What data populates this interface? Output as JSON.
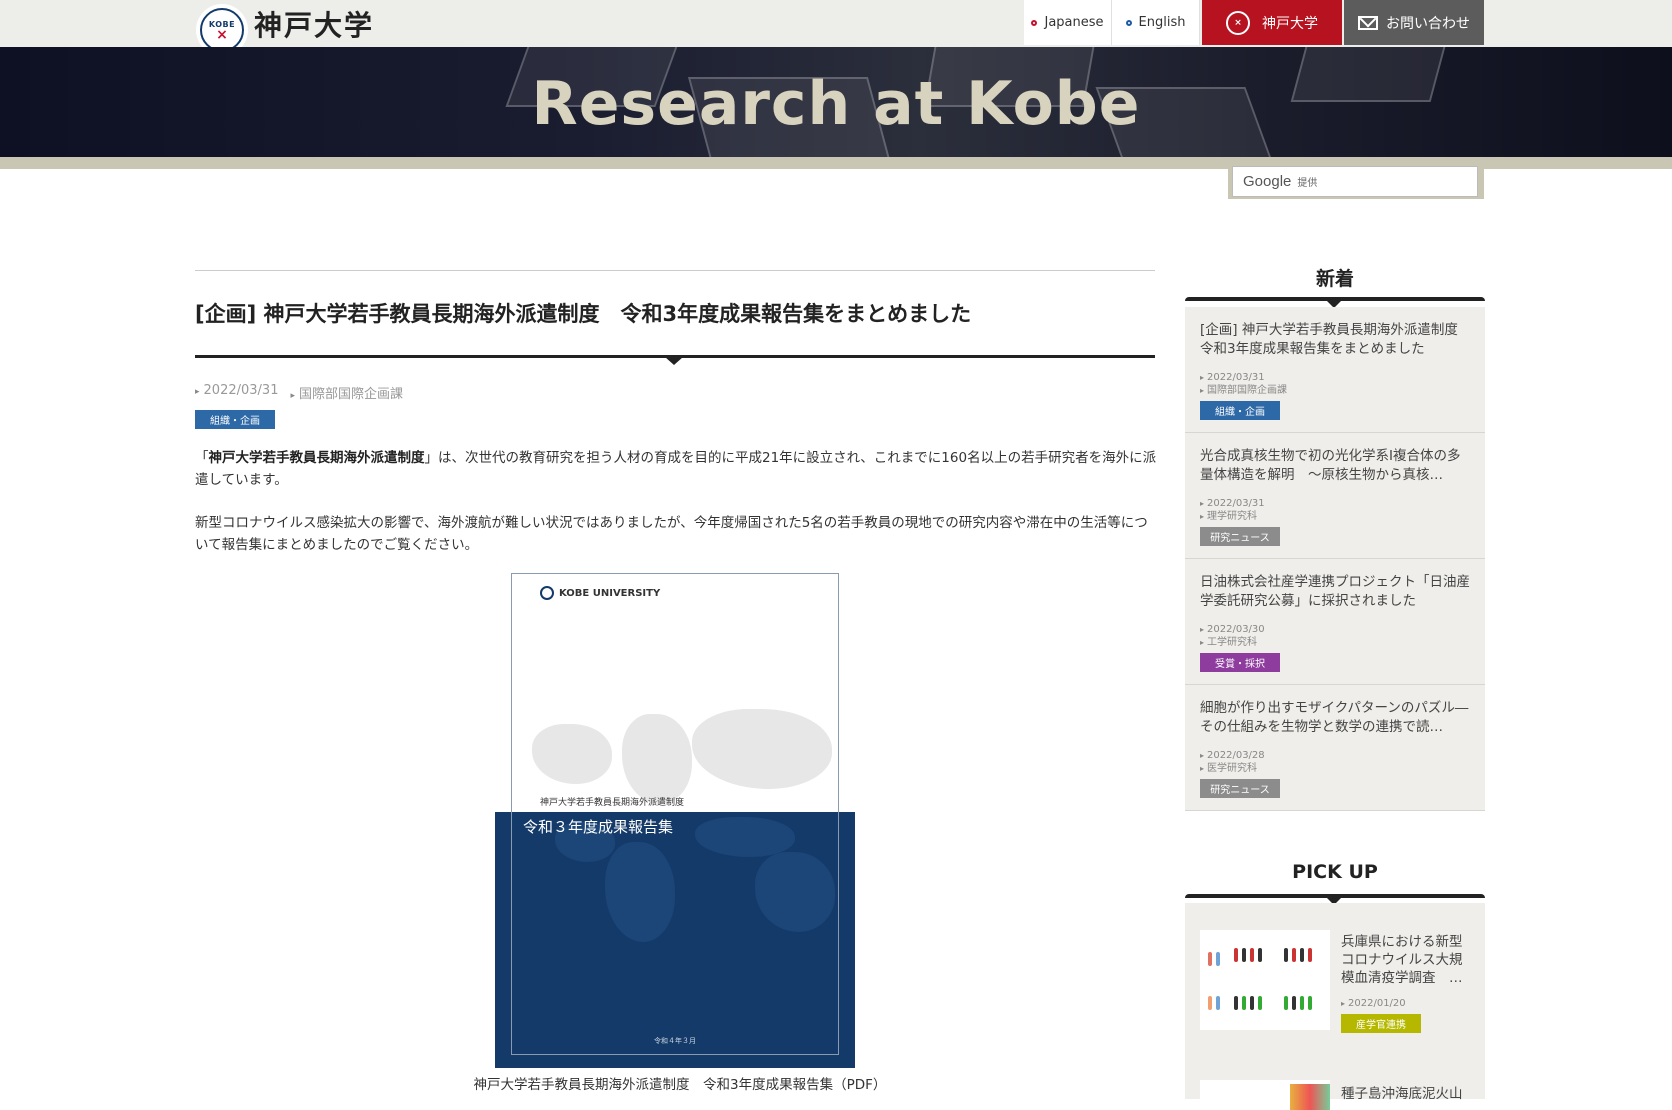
{
  "header": {
    "logo_text": "神戸大学",
    "logo_mark_text": "KOBE",
    "nav": {
      "japanese": "Japanese",
      "english": "English",
      "university": "神戸大学",
      "contact": "お問い合わせ"
    }
  },
  "banner": {
    "title": "Research at Kobe"
  },
  "search": {
    "brand": "Google",
    "provided": "提供"
  },
  "article": {
    "title": "[企画] 神戸大学若手教員長期海外派遣制度　令和3年度成果報告集をまとめました",
    "date": "2022/03/31",
    "department": "国際部国際企画課",
    "tag": "組織・企画",
    "p1_open": "「",
    "p1_bold": "神戸大学若手教員長期海外派遣制度",
    "p1_rest": "」は、次世代の教育研究を担う人材の育成を目的に平成21年に設立され、これまでに160名以上の若手研究者を海外に派遣しています。",
    "p2": "新型コロナウイルス感染拡大の影響で、海外渡航が難しい状況ではありましたが、今年度帰国された5名の若手教員の現地での研究内容や滞在中の生活等について報告集にまとめましたのでご覧ください。",
    "cover": {
      "logo": "KOBE UNIVERSITY",
      "subtitle": "神戸大学若手教員長期海外派遣制度",
      "title": "令和３年度成果報告集",
      "date": "令和４年３月"
    },
    "caption": "神戸大学若手教員長期海外派遣制度　令和3年度成果報告集（PDF）"
  },
  "sidebar": {
    "news_heading": "新着",
    "news": [
      {
        "title": "[企画] 神戸大学若手教員長期海外派遣制度　令和3年度成果報告集をまとめました",
        "date": "2022/03/31",
        "dept": "国際部国際企画課",
        "tag": "組織・企画",
        "tag_color": "#2d68a7"
      },
      {
        "title": "光合成真核生物で初の光化学系I複合体の多量体構造を解明　～原核生物から真核…",
        "date": "2022/03/31",
        "dept": "理学研究科",
        "tag": "研究ニュース",
        "tag_color": "#8c8c8c"
      },
      {
        "title": "日油株式会社産学連携プロジェクト「日油産学委託研究公募」に採択されました",
        "date": "2022/03/30",
        "dept": "工学研究科",
        "tag": "受賞・採択",
        "tag_color": "#8e3c9e"
      },
      {
        "title": "細胞が作り出すモザイクパターンのパズル―その仕組みを生物学と数学の連携で読…",
        "date": "2022/03/28",
        "dept": "医学研究科",
        "tag": "研究ニュース",
        "tag_color": "#8c8c8c"
      }
    ],
    "pickup_heading": "PICK UP",
    "pickup": [
      {
        "title": "兵庫県における新型コロナウイルス大規模血清疫学調査　…",
        "date": "2022/01/20",
        "tag": "産学官連携",
        "tag_color": "#b6b800"
      },
      {
        "title": "種子島沖海底泥火山"
      }
    ]
  }
}
